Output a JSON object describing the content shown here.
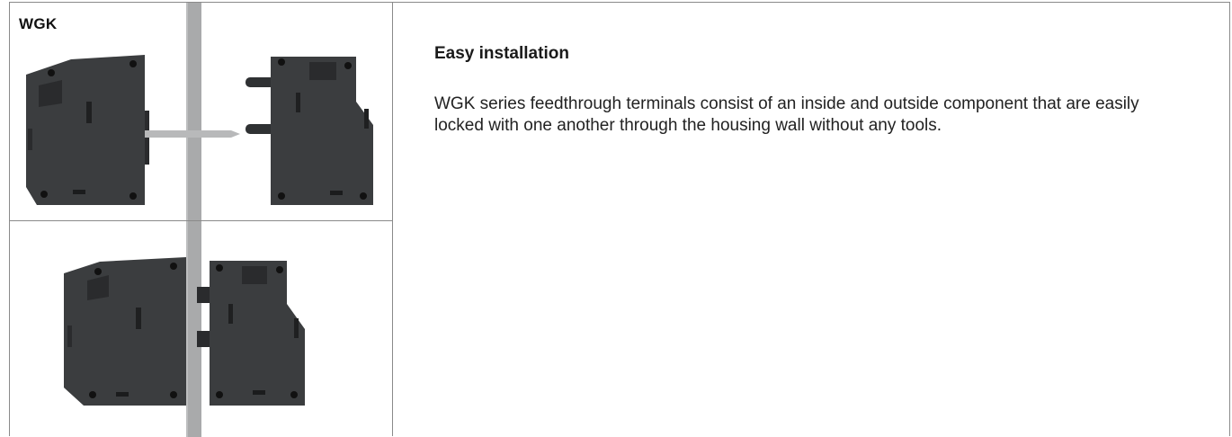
{
  "images": {
    "top_label": "WGK"
  },
  "content": {
    "heading": "Easy installation",
    "description": "WGK series feedthrough terminals consist of an inside and outside component that are easily locked with one another through the housing wall without any tools."
  },
  "colors": {
    "terminal_body": "#3b3d3f",
    "wall": "#a9aaab",
    "border": "#8a8a8a"
  }
}
